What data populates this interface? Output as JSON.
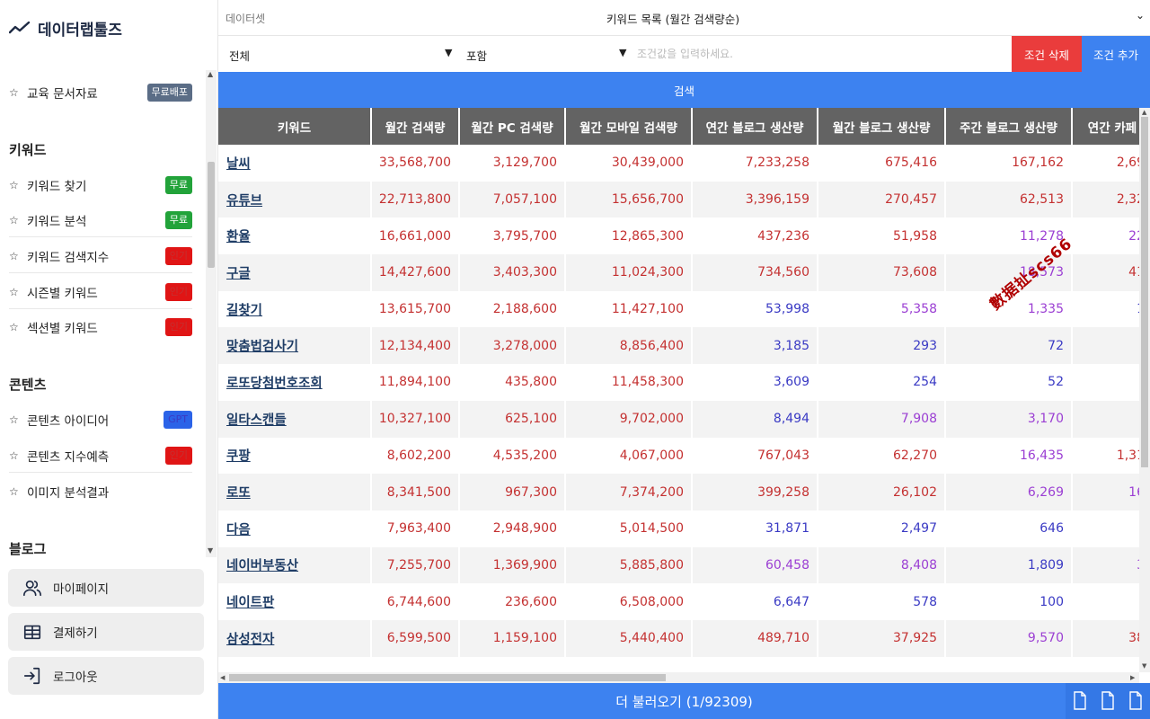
{
  "app": {
    "logo_text": "데이터랩툴즈"
  },
  "sidebar": {
    "items": [
      {
        "label": "교육 문서자료",
        "badge": "무료배포",
        "badge_color": "gray"
      },
      {
        "label": "키워드 찾기",
        "badge": "무료",
        "badge_color": "green"
      },
      {
        "label": "키워드 분석",
        "badge": "무료",
        "badge_color": "green"
      },
      {
        "label": "키워드 검색지수",
        "badge": "인기",
        "badge_color": "red"
      },
      {
        "label": "시즌별 키워드",
        "badge": "인기",
        "badge_color": "red"
      },
      {
        "label": "섹션별 키워드",
        "badge": "인기",
        "badge_color": "red"
      },
      {
        "label": "콘텐츠 아이디어",
        "badge": "GPT",
        "badge_color": "blue"
      },
      {
        "label": "콘텐츠 지수예측",
        "badge": "인기",
        "badge_color": "red"
      },
      {
        "label": "이미지 분석결과",
        "badge": "",
        "badge_color": ""
      }
    ],
    "sections": {
      "keyword": "키워드",
      "content": "콘텐츠",
      "blog": "블로그"
    },
    "star": "☆",
    "bottom": {
      "mypage": "마이페이지",
      "payment": "결제하기",
      "logout": "로그아웃"
    }
  },
  "header": {
    "dataset_label": "데이터셋",
    "dataset_value": "키워드 목록 (월간 검색량순)",
    "filter_field": "전체",
    "filter_op": "포함",
    "filter_placeholder": "조건값을 입력하세요.",
    "delete_button": "조건 삭제",
    "add_button": "조건 추가",
    "search_button": "검색"
  },
  "table": {
    "columns": [
      "키워드",
      "월간 검색량",
      "월간 PC 검색량",
      "월간 모바일 검색량",
      "연간 블로그 생산량",
      "월간 블로그 생산량",
      "주간 블로그 생산량",
      "연간 카페"
    ],
    "rows": [
      [
        "날씨",
        "33,568,700",
        "3,129,700",
        "30,439,000",
        "7,233,258",
        "675,416",
        "167,162",
        "2,69"
      ],
      [
        "유튜브",
        "22,713,800",
        "7,057,100",
        "15,656,700",
        "3,396,159",
        "270,457",
        "62,513",
        "2,32"
      ],
      [
        "환율",
        "16,661,000",
        "3,795,700",
        "12,865,300",
        "437,236",
        "51,958",
        "11,278",
        "22"
      ],
      [
        "구글",
        "14,427,600",
        "3,403,300",
        "11,024,300",
        "734,560",
        "73,608",
        "18,573",
        "41"
      ],
      [
        "길찾기",
        "13,615,700",
        "2,188,600",
        "11,427,100",
        "53,998",
        "5,358",
        "1,335",
        "1"
      ],
      [
        "맞춤법검사기",
        "12,134,400",
        "3,278,000",
        "8,856,400",
        "3,185",
        "293",
        "72",
        ""
      ],
      [
        "로또당첨번호조회",
        "11,894,100",
        "435,800",
        "11,458,300",
        "3,609",
        "254",
        "52",
        ""
      ],
      [
        "일타스캔들",
        "10,327,100",
        "625,100",
        "9,702,000",
        "8,494",
        "7,908",
        "3,170",
        ""
      ],
      [
        "쿠팡",
        "8,602,200",
        "4,535,200",
        "4,067,000",
        "767,043",
        "62,270",
        "16,435",
        "1,31"
      ],
      [
        "로또",
        "8,341,500",
        "967,300",
        "7,374,200",
        "399,258",
        "26,102",
        "6,269",
        "16"
      ],
      [
        "다음",
        "7,963,400",
        "2,948,900",
        "5,014,500",
        "31,871",
        "2,497",
        "646",
        ""
      ],
      [
        "네이버부동산",
        "7,255,700",
        "1,369,900",
        "5,885,800",
        "60,458",
        "8,408",
        "1,809",
        "3"
      ],
      [
        "네이트판",
        "6,744,600",
        "236,600",
        "6,508,000",
        "6,647",
        "578",
        "100",
        ""
      ],
      [
        "삼성전자",
        "6,599,500",
        "1,159,100",
        "5,440,400",
        "489,710",
        "37,925",
        "9,570",
        "38"
      ]
    ],
    "colors": [
      [
        "red",
        "red",
        "red",
        "red",
        "red",
        "red",
        "red"
      ],
      [
        "red",
        "red",
        "red",
        "red",
        "red",
        "red",
        "red"
      ],
      [
        "red",
        "red",
        "red",
        "red",
        "red",
        "purple",
        "purple"
      ],
      [
        "red",
        "red",
        "red",
        "red",
        "red",
        "purple",
        "red"
      ],
      [
        "red",
        "red",
        "red",
        "blue",
        "purple",
        "purple",
        "blue"
      ],
      [
        "red",
        "red",
        "red",
        "blue",
        "blue",
        "blue",
        "blue"
      ],
      [
        "red",
        "red",
        "red",
        "blue",
        "blue",
        "blue",
        "blue"
      ],
      [
        "red",
        "red",
        "red",
        "blue",
        "purple",
        "purple",
        "blue"
      ],
      [
        "red",
        "red",
        "red",
        "red",
        "red",
        "purple",
        "red"
      ],
      [
        "red",
        "red",
        "red",
        "red",
        "red",
        "purple",
        "purple"
      ],
      [
        "red",
        "red",
        "red",
        "blue",
        "blue",
        "blue",
        "blue"
      ],
      [
        "red",
        "red",
        "red",
        "purple",
        "purple",
        "blue",
        "purple"
      ],
      [
        "red",
        "red",
        "red",
        "blue",
        "blue",
        "blue",
        "blue"
      ],
      [
        "red",
        "red",
        "red",
        "red",
        "red",
        "purple",
        "red"
      ]
    ]
  },
  "watermark": "數据扯scs66",
  "footer": {
    "load_more": "더 불러오기 (1/92309)"
  }
}
